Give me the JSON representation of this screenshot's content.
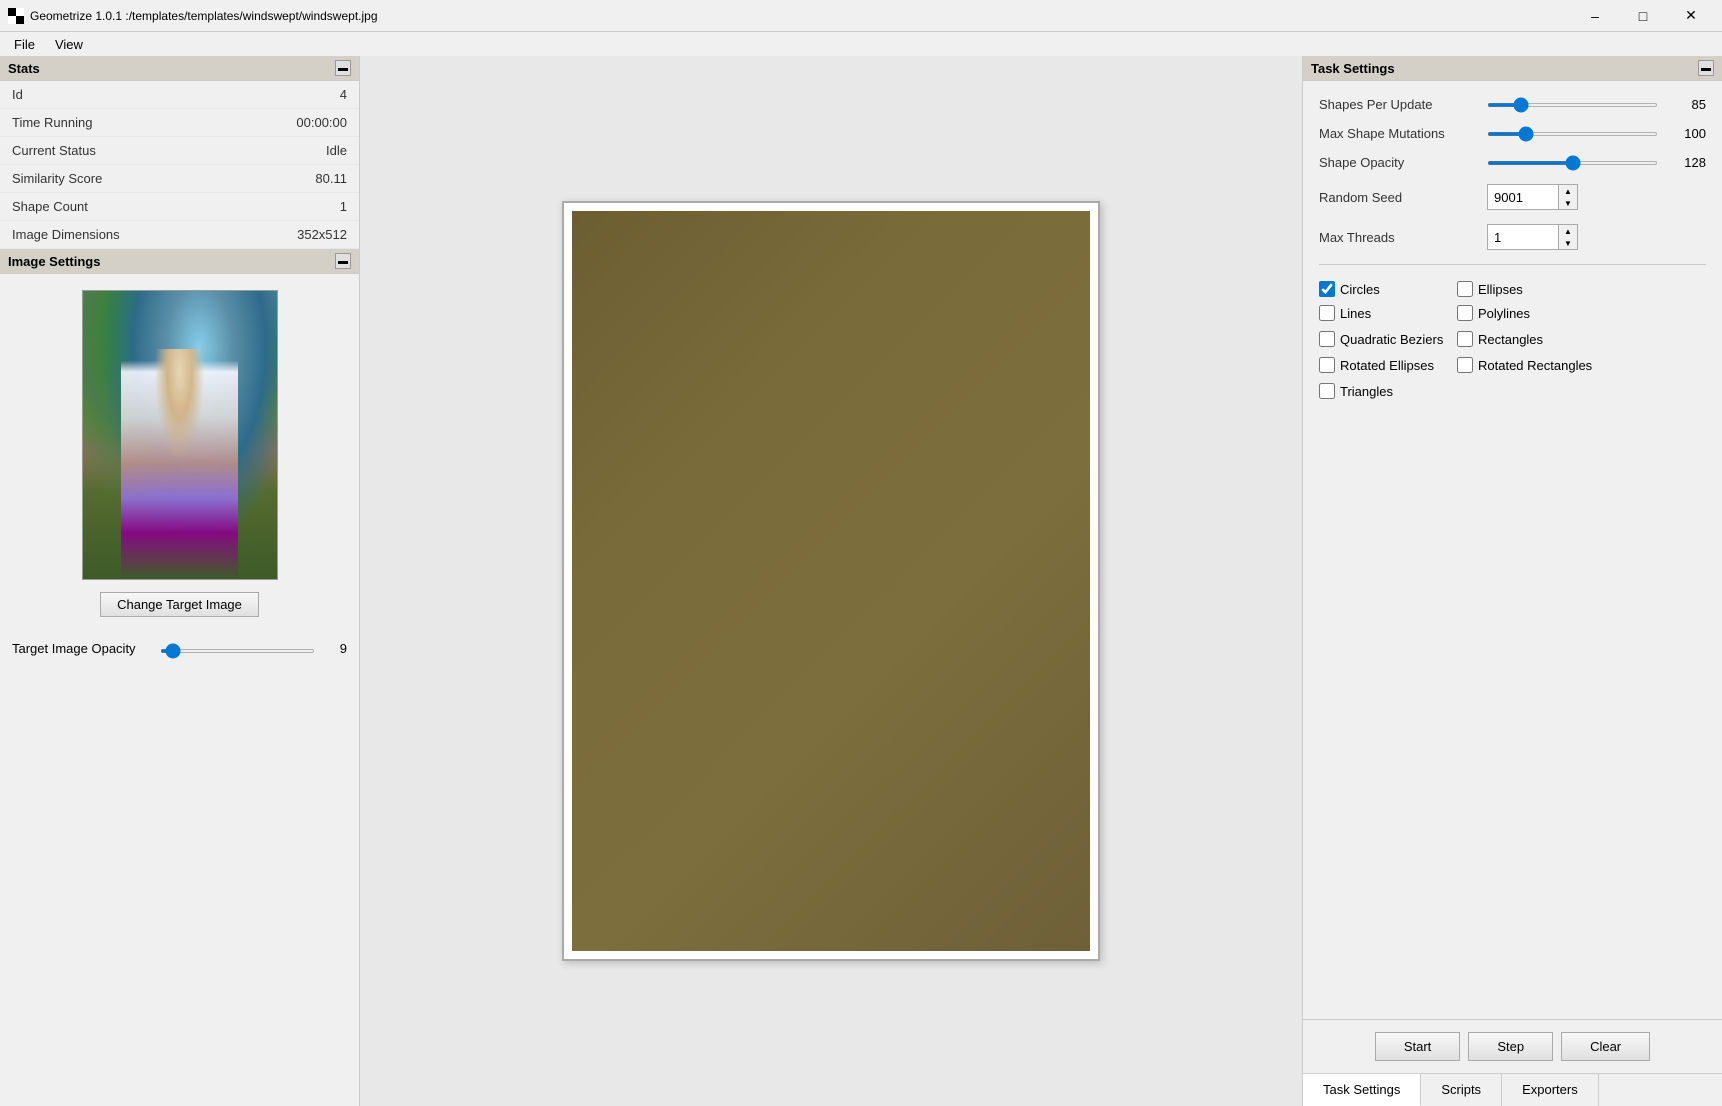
{
  "titleBar": {
    "title": "Geometrize 1.0.1 :/templates/templates/windswept/windswept.jpg",
    "minBtn": "–",
    "maxBtn": "□",
    "closeBtn": "✕"
  },
  "menuBar": {
    "items": [
      "File",
      "View"
    ]
  },
  "stats": {
    "title": "Stats",
    "rows": [
      {
        "label": "Id",
        "value": "4"
      },
      {
        "label": "Time Running",
        "value": "00:00:00"
      },
      {
        "label": "Current Status",
        "value": "Idle"
      },
      {
        "label": "Similarity Score",
        "value": "80.11"
      },
      {
        "label": "Shape Count",
        "value": "1"
      },
      {
        "label": "Image Dimensions",
        "value": "352x512"
      }
    ]
  },
  "imageSettings": {
    "title": "Image Settings",
    "changeImageBtn": "Change Target Image",
    "targetOpacityLabel": "Target Image Opacity",
    "targetOpacityValue": "9",
    "targetOpacityMin": "0",
    "targetOpacityMax": "255"
  },
  "taskSettings": {
    "title": "Task Settings",
    "shapesPerUpdateLabel": "Shapes Per Update",
    "shapesPerUpdateValue": "85",
    "shapesPerUpdateMin": "1",
    "shapesPerUpdateMax": "500",
    "maxShapeMutationsLabel": "Max Shape Mutations",
    "maxShapeMutationsValue": "100",
    "maxShapeMutationsMin": "1",
    "maxShapeMutationsMax": "500",
    "shapeOpacityLabel": "Shape Opacity",
    "shapeOpacityValue": "128",
    "shapeOpacityMin": "0",
    "shapeOpacityMax": "255",
    "randomSeedLabel": "Random Seed",
    "randomSeedValue": "9001",
    "maxThreadsLabel": "Max Threads",
    "maxThreadsValue": "1",
    "checkboxes": [
      {
        "id": "cb-circles",
        "label": "Circles",
        "checked": true
      },
      {
        "id": "cb-ellipses",
        "label": "Ellipses",
        "checked": false
      },
      {
        "id": "cb-lines",
        "label": "Lines",
        "checked": false
      },
      {
        "id": "cb-polylines",
        "label": "Polylines",
        "checked": false
      },
      {
        "id": "cb-quadratic",
        "label": "Quadratic Beziers",
        "checked": false
      },
      {
        "id": "cb-rectangles",
        "label": "Rectangles",
        "checked": false
      },
      {
        "id": "cb-rotated-ellipses",
        "label": "Rotated Ellipses",
        "checked": false
      },
      {
        "id": "cb-rotated-rectangles",
        "label": "Rotated Rectangles",
        "checked": false
      },
      {
        "id": "cb-triangles",
        "label": "Triangles",
        "checked": false
      }
    ],
    "startBtn": "Start",
    "stepBtn": "Step",
    "clearBtn": "Clear"
  },
  "bottomTabs": {
    "tabs": [
      "Task Settings",
      "Scripts",
      "Exporters"
    ]
  }
}
